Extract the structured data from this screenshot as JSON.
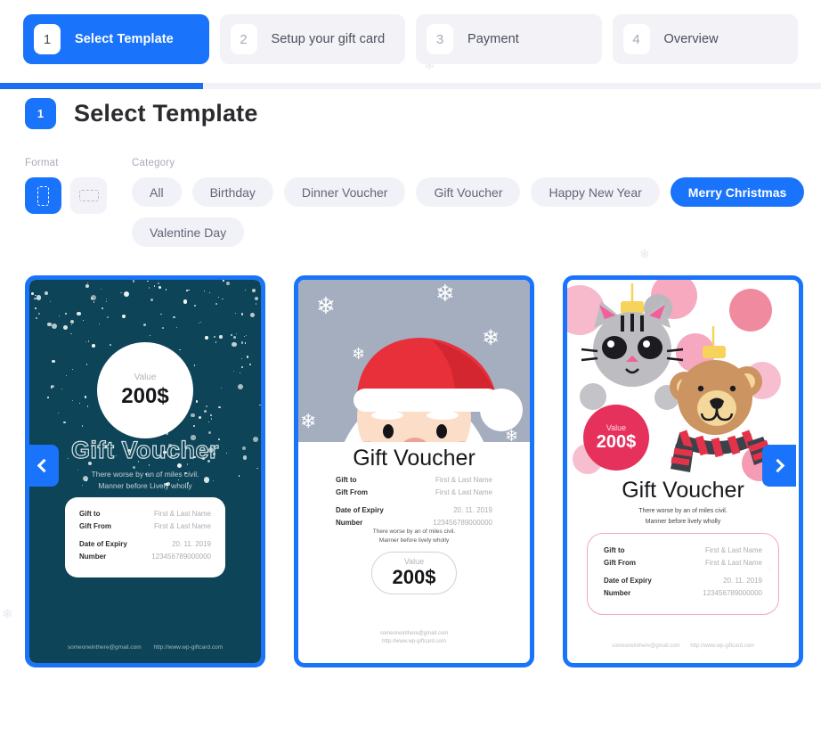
{
  "stepper": {
    "steps": [
      {
        "num": "1",
        "label": "Select Template",
        "active": true
      },
      {
        "num": "2",
        "label": "Setup your gift card",
        "active": false
      },
      {
        "num": "3",
        "label": "Payment",
        "active": false
      },
      {
        "num": "4",
        "label": "Overview",
        "active": false
      }
    ]
  },
  "progress": {
    "percent": "24.7%"
  },
  "section": {
    "badge": "1",
    "title": "Select Template"
  },
  "filters": {
    "format_label": "Format",
    "category_label": "Category",
    "formats": [
      {
        "name": "portrait",
        "selected": true
      },
      {
        "name": "landscape",
        "selected": false
      }
    ],
    "categories": [
      {
        "label": "All",
        "active": false
      },
      {
        "label": "Birthday",
        "active": false
      },
      {
        "label": "Dinner Voucher",
        "active": false
      },
      {
        "label": "Gift Voucher",
        "active": false
      },
      {
        "label": "Happy New Year",
        "active": false
      },
      {
        "label": "Merry Christmas",
        "active": true
      },
      {
        "label": "Valentine Day",
        "active": false
      }
    ]
  },
  "carousel": {
    "prev_label": "‹",
    "next_label": "›"
  },
  "common": {
    "value_label": "Value",
    "value_amount": "200$",
    "title": "Gift Voucher",
    "tagline_line1": "There worse by  an of miles civil.",
    "tagline_line2": "Manner before lively wholly",
    "tagline_line2_alt": "Manner before Lively wholly",
    "fields": {
      "gift_to_label": "Gift to",
      "gift_to_value": "First & Last Name",
      "gift_from_label": "Gift From",
      "gift_from_value": "First & Last Name",
      "expiry_label": "Date of Expiry",
      "expiry_value": "20. 11. 2019",
      "number_label": "Number",
      "number_value": "123456789000000"
    },
    "footer_email": "someoneinthere@gmail.com",
    "footer_url": "http://www.wp-giftcard.com"
  },
  "colors": {
    "accent": "#1a73fb",
    "chip_bg": "#f1f1f8",
    "card1_bg": "#0d4457",
    "card2_bg": "#a5aebf",
    "card3_accent": "#e5315c"
  }
}
